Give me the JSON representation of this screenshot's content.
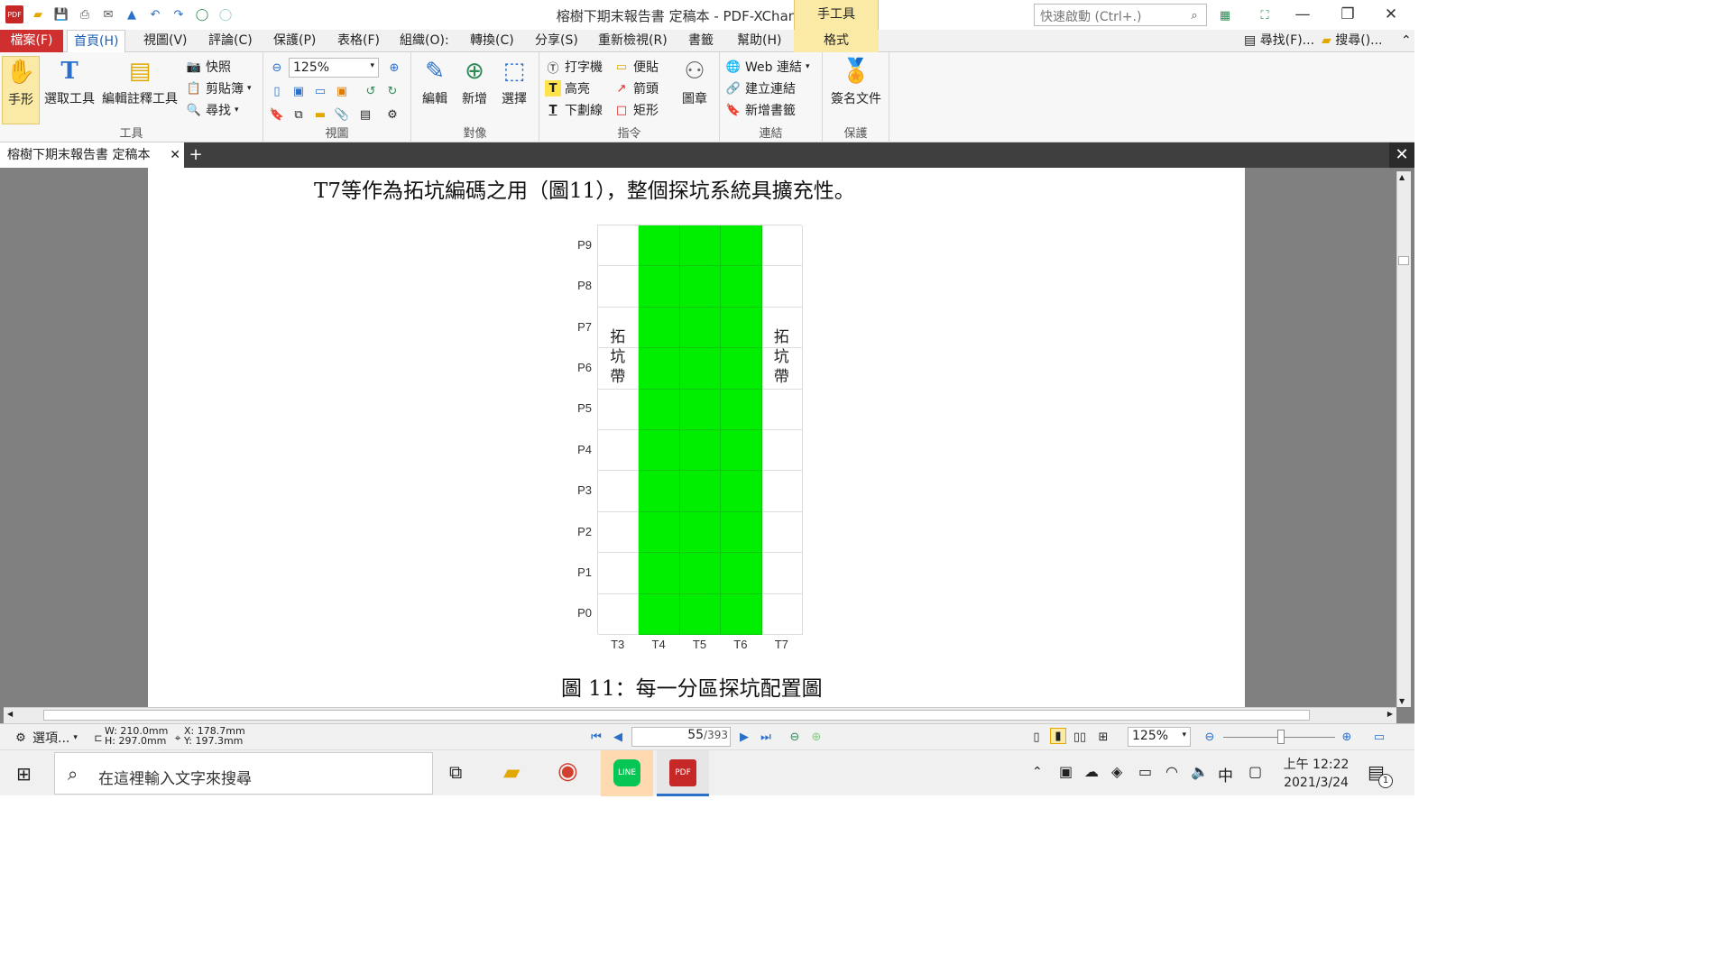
{
  "window": {
    "title": "榕樹下期末報告書 定稿本 - PDF-XChange Editor",
    "context_tab": "手工具",
    "context_subtab": "格式",
    "quick_launch_placeholder": "快速啟動 (Ctrl+.)"
  },
  "menu": {
    "file": "檔案(F)",
    "items": [
      "首頁(H)",
      "視圖(V)",
      "評論(C)",
      "保護(P)",
      "表格(F)",
      "組織(O):",
      "轉換(C)",
      "分享(S)",
      "重新檢視(R)",
      "書籤",
      "幫助(H)"
    ],
    "find": "尋找(F)...",
    "search": "搜尋()..."
  },
  "ribbon": {
    "tools": {
      "label": "工具",
      "hand": "手形",
      "select": "選取工具",
      "edit_annot": "編輯註釋工具",
      "snapshot": "快照",
      "clipboard": "剪貼簿",
      "find": "尋找"
    },
    "view": {
      "label": "視圖",
      "zoom": "125%"
    },
    "objects": {
      "label": "對像",
      "edit": "編輯",
      "add": "新增",
      "select": "選擇"
    },
    "commands": {
      "label": "指令",
      "typewriter": "打字機",
      "sticky": "便貼",
      "highlight": "高亮",
      "arrow": "箭頭",
      "underline": "下劃線",
      "rect": "矩形"
    },
    "stamp": "圖章",
    "links": {
      "label": "連結",
      "web": "Web 連結",
      "create": "建立連結",
      "bookmark": "新增書籤"
    },
    "protect": {
      "label": "保護",
      "sign": "簽名文件"
    }
  },
  "doc_tab": {
    "name": "榕樹下期末報告書 定稿本"
  },
  "page": {
    "top_text": "T7等作為拓坑編碼之用（圖11），整個探坑系統具擴充性。",
    "caption": "圖 11：每一分區探坑配置圖",
    "side_label": "拓坑帶"
  },
  "chart_data": {
    "type": "heatmap",
    "x_categories": [
      "T3",
      "T4",
      "T5",
      "T6",
      "T7"
    ],
    "y_categories": [
      "P0",
      "P1",
      "P2",
      "P3",
      "P4",
      "P5",
      "P6",
      "P7",
      "P8",
      "P9"
    ],
    "filled_columns": [
      "T4",
      "T5",
      "T6"
    ],
    "fill_color": "#00ee00",
    "annotations": [
      {
        "column": "T3",
        "text": "拓坑帶"
      },
      {
        "column": "T7",
        "text": "拓坑帶"
      }
    ]
  },
  "status": {
    "options": "選項...",
    "w": "W: 210.0mm",
    "h": "H: 297.0mm",
    "x": "X: 178.7mm",
    "y": "Y: 197.3mm",
    "page_current": "55",
    "page_total": "/393",
    "zoom": "125%"
  },
  "taskbar": {
    "search_placeholder": "在這裡輸入文字來搜尋",
    "ime": "中",
    "time": "上午 12:22",
    "date": "2021/3/24",
    "notif_count": "1"
  },
  "colors": {
    "accent": "#cf2f2f",
    "ribbon_ctx": "#fbeaa6",
    "grid_fill": "#00ee00"
  }
}
